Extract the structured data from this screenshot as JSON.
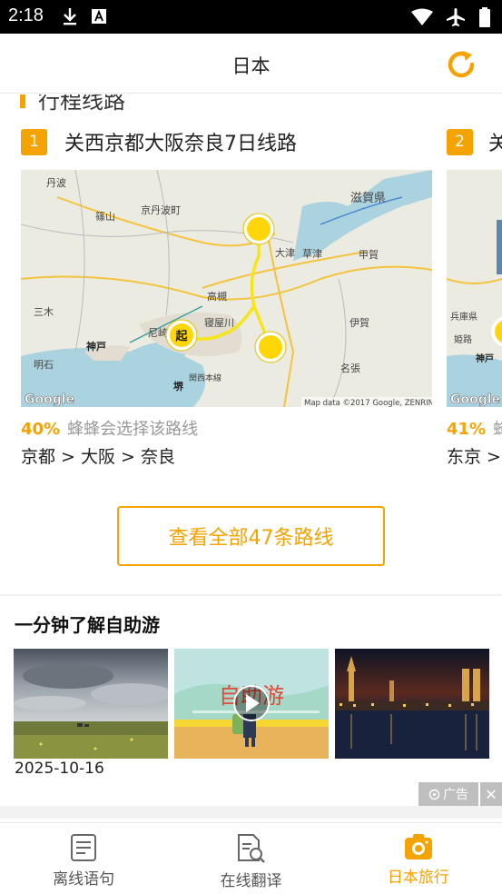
{
  "status_bar": {
    "time": "2:18"
  },
  "header": {
    "title": "日本"
  },
  "routes_section": {
    "title": "行程线路",
    "routes": [
      {
        "index": "1",
        "name": "关西京都大阪奈良7日线路",
        "percent": "40%",
        "choose_text": "蜂蜂会选择该路线",
        "cities": "京都 > 大阪 > 奈良",
        "map": {
          "labels": [
            "丹波",
            "篠山",
            "京丹波町",
            "大津",
            "草津",
            "滋賀県",
            "甲賀",
            "高槻",
            "三木",
            "神戸",
            "尼崎",
            "寝屋川",
            "伊賀",
            "明石",
            "名張",
            "堺",
            "関西本線"
          ],
          "start_marker": "起",
          "attribution": "Map data ©2017 Google, ZENRIN",
          "logo": "Google"
        }
      },
      {
        "index": "2",
        "name": "关",
        "percent": "41%",
        "choose_text": "蜂",
        "cities": "东京 >",
        "map": {
          "labels": [
            "兵庫県",
            "姫路",
            "神戸"
          ],
          "logo": "Google"
        }
      }
    ],
    "view_all": "查看全部47条路线"
  },
  "videos_section": {
    "title": "一分钟了解自助游",
    "videos": [
      {
        "date": "2025-10-16"
      },
      {
        "overlay_text": "自助游"
      },
      {}
    ]
  },
  "ad": {
    "label": "广告",
    "close": "✕"
  },
  "tabs": [
    {
      "label": "离线语句",
      "icon": "phrasebook-icon",
      "active": false
    },
    {
      "label": "在线翻译",
      "icon": "translate-doc-icon",
      "active": false
    },
    {
      "label": "日本旅行",
      "icon": "travel-camera-icon",
      "active": true
    }
  ],
  "colors": {
    "accent": "#f5a300",
    "text": "#222222",
    "muted": "#999999"
  }
}
